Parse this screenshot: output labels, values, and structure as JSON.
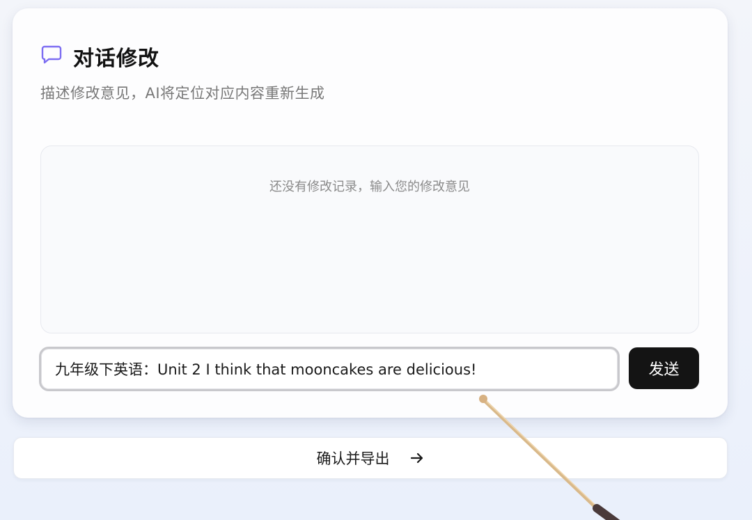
{
  "header": {
    "title": "对话修改",
    "subtitle": "描述修改意见，AI将定位对应内容重新生成",
    "icon": "chat-bubble-icon",
    "icon_color": "#7c6df2"
  },
  "history": {
    "empty_text": "还没有修改记录，输入您的修改意见"
  },
  "composer": {
    "input_value": "九年级下英语：Unit 2 I think that mooncakes are delicious!",
    "send_label": "发送"
  },
  "footer": {
    "export_label": "确认并导出",
    "export_icon": "arrow-right-icon"
  },
  "colors": {
    "accent": "#7c6df2",
    "send_bg": "#141414"
  }
}
